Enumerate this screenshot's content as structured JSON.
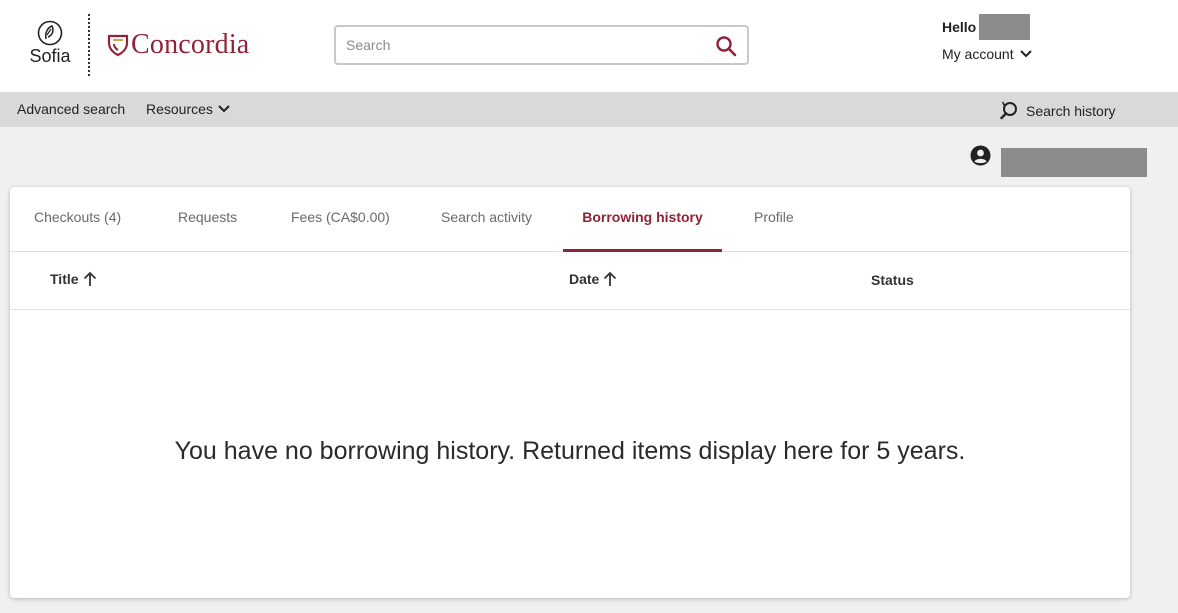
{
  "header": {
    "sofia_label": "Sofia",
    "concordia_label": "Concordia",
    "search_placeholder": "Search",
    "greeting": "Hello",
    "my_account_label": "My account"
  },
  "nav": {
    "advanced_search": "Advanced search",
    "resources": "Resources",
    "search_history": "Search history"
  },
  "tabs": [
    {
      "label": "Checkouts (4)",
      "active": false
    },
    {
      "label": "Requests",
      "active": false
    },
    {
      "label": "Fees (CA$0.00)",
      "active": false
    },
    {
      "label": "Search activity",
      "active": false
    },
    {
      "label": "Borrowing history",
      "active": true
    },
    {
      "label": "Profile",
      "active": false
    }
  ],
  "table": {
    "columns": [
      "Title",
      "Date",
      "Status"
    ]
  },
  "empty_message": "You have no borrowing history. Returned items display here for 5 years.",
  "colors": {
    "brand": "#912338",
    "navbar": "#d9d9d9",
    "background": "#f0f0f1"
  }
}
